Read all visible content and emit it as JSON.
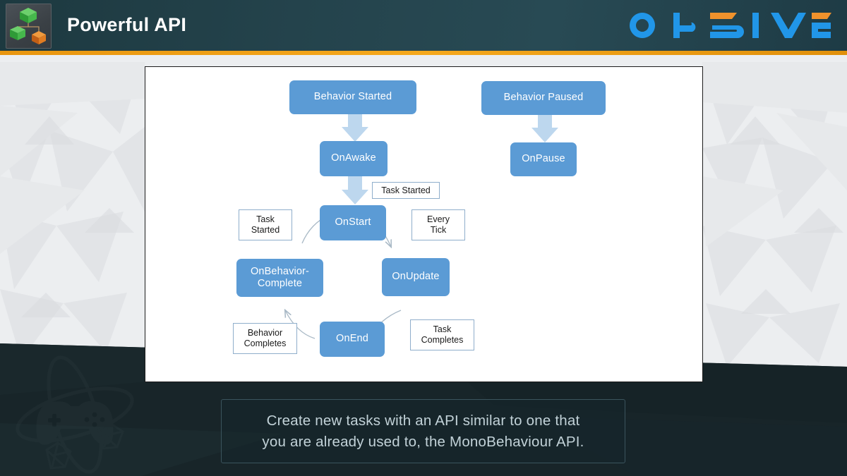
{
  "header": {
    "title": "Powerful API",
    "brand": "OPSIVE",
    "brand_letters": [
      "O",
      "P",
      "S",
      "I",
      "V",
      "E"
    ],
    "logo_icon": "behavior-tree-cubes-icon",
    "accent_color": "#f0a018",
    "background_color": "#24434c"
  },
  "diagram": {
    "node_color": "#5b9bd5",
    "label_border_color": "#8faecb",
    "arrow_color": "#bdd7ee",
    "curve_arrow_color": "#a9b9c6",
    "nodes": [
      {
        "id": "behavior-started",
        "label": "Behavior Started"
      },
      {
        "id": "behavior-paused",
        "label": "Behavior Paused"
      },
      {
        "id": "on-awake",
        "label": "OnAwake"
      },
      {
        "id": "on-pause",
        "label": "OnPause"
      },
      {
        "id": "on-start",
        "label": "OnStart"
      },
      {
        "id": "on-behavior-complete",
        "label": "OnBehavior-\nComplete"
      },
      {
        "id": "on-update",
        "label": "OnUpdate"
      },
      {
        "id": "on-end",
        "label": "OnEnd"
      }
    ],
    "labels": [
      {
        "id": "task-started-top",
        "text": "Task Started"
      },
      {
        "id": "task-started-left",
        "text": "Task\nStarted"
      },
      {
        "id": "every-tick",
        "text": "Every\nTick"
      },
      {
        "id": "behavior-completes",
        "text": "Behavior\nCompletes"
      },
      {
        "id": "task-completes",
        "text": "Task\nCompletes"
      }
    ]
  },
  "caption": {
    "text": "Create new tasks with an API similar to one that\nyou are already used to, the MonoBehaviour API."
  },
  "watermark": {
    "icon": "gamepad-atom-watermark-icon"
  }
}
